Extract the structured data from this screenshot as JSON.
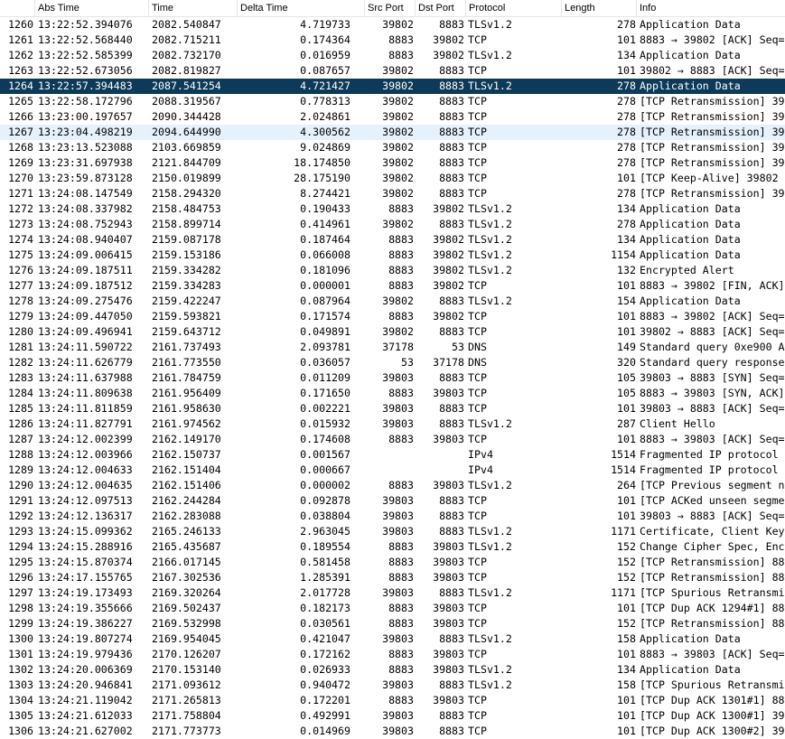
{
  "columns": [
    "",
    "Abs Time",
    "Time",
    "Delta Time",
    "Src Port",
    "Dst Port",
    "Protocol",
    "Length",
    "Info"
  ],
  "selected_no": "1264",
  "hovered_no": "1267",
  "colors": {
    "selected_bg": "#0d3a58",
    "hover_bg": "#e5f1fb"
  },
  "packets": [
    [
      "1260",
      "13:22:52.394076",
      "2082.540847",
      "4.719733",
      "39802",
      "8883",
      "TLSv1.2",
      "278",
      "Application Data"
    ],
    [
      "1261",
      "13:22:52.568440",
      "2082.715211",
      "0.174364",
      "8883",
      "39802",
      "TCP",
      "101",
      "8883 → 39802 [ACK] Seq="
    ],
    [
      "1262",
      "13:22:52.585399",
      "2082.732170",
      "0.016959",
      "8883",
      "39802",
      "TLSv1.2",
      "134",
      "Application Data"
    ],
    [
      "1263",
      "13:22:52.673056",
      "2082.819827",
      "0.087657",
      "39802",
      "8883",
      "TCP",
      "101",
      "39802 → 8883 [ACK] Seq="
    ],
    [
      "1264",
      "13:22:57.394483",
      "2087.541254",
      "4.721427",
      "39802",
      "8883",
      "TLSv1.2",
      "278",
      "Application Data"
    ],
    [
      "1265",
      "13:22:58.172796",
      "2088.319567",
      "0.778313",
      "39802",
      "8883",
      "TCP",
      "278",
      "[TCP Retransmission] 39"
    ],
    [
      "1266",
      "13:23:00.197657",
      "2090.344428",
      "2.024861",
      "39802",
      "8883",
      "TCP",
      "278",
      "[TCP Retransmission] 39"
    ],
    [
      "1267",
      "13:23:04.498219",
      "2094.644990",
      "4.300562",
      "39802",
      "8883",
      "TCP",
      "278",
      "[TCP Retransmission] 39"
    ],
    [
      "1268",
      "13:23:13.523088",
      "2103.669859",
      "9.024869",
      "39802",
      "8883",
      "TCP",
      "278",
      "[TCP Retransmission] 39"
    ],
    [
      "1269",
      "13:23:31.697938",
      "2121.844709",
      "18.174850",
      "39802",
      "8883",
      "TCP",
      "278",
      "[TCP Retransmission] 39"
    ],
    [
      "1270",
      "13:23:59.873128",
      "2150.019899",
      "28.175190",
      "39802",
      "8883",
      "TCP",
      "101",
      "[TCP Keep-Alive] 39802"
    ],
    [
      "1271",
      "13:24:08.147549",
      "2158.294320",
      "8.274421",
      "39802",
      "8883",
      "TCP",
      "278",
      "[TCP Retransmission] 39"
    ],
    [
      "1272",
      "13:24:08.337982",
      "2158.484753",
      "0.190433",
      "8883",
      "39802",
      "TLSv1.2",
      "134",
      "Application Data"
    ],
    [
      "1273",
      "13:24:08.752943",
      "2158.899714",
      "0.414961",
      "39802",
      "8883",
      "TLSv1.2",
      "278",
      "Application Data"
    ],
    [
      "1274",
      "13:24:08.940407",
      "2159.087178",
      "0.187464",
      "8883",
      "39802",
      "TLSv1.2",
      "134",
      "Application Data"
    ],
    [
      "1275",
      "13:24:09.006415",
      "2159.153186",
      "0.066008",
      "8883",
      "39802",
      "TLSv1.2",
      "1154",
      "Application Data"
    ],
    [
      "1276",
      "13:24:09.187511",
      "2159.334282",
      "0.181096",
      "8883",
      "39802",
      "TLSv1.2",
      "132",
      "Encrypted Alert"
    ],
    [
      "1277",
      "13:24:09.187512",
      "2159.334283",
      "0.000001",
      "8883",
      "39802",
      "TCP",
      "101",
      "8883 → 39802 [FIN, ACK]"
    ],
    [
      "1278",
      "13:24:09.275476",
      "2159.422247",
      "0.087964",
      "39802",
      "8883",
      "TLSv1.2",
      "154",
      "Application Data"
    ],
    [
      "1279",
      "13:24:09.447050",
      "2159.593821",
      "0.171574",
      "8883",
      "39802",
      "TCP",
      "101",
      "8883 → 39802 [ACK] Seq="
    ],
    [
      "1280",
      "13:24:09.496941",
      "2159.643712",
      "0.049891",
      "39802",
      "8883",
      "TCP",
      "101",
      "39802 → 8883 [ACK] Seq="
    ],
    [
      "1281",
      "13:24:11.590722",
      "2161.737493",
      "2.093781",
      "37178",
      "53",
      "DNS",
      "149",
      "Standard query 0xe900 A"
    ],
    [
      "1282",
      "13:24:11.626779",
      "2161.773550",
      "0.036057",
      "53",
      "37178",
      "DNS",
      "320",
      "Standard query response"
    ],
    [
      "1283",
      "13:24:11.637988",
      "2161.784759",
      "0.011209",
      "39803",
      "8883",
      "TCP",
      "105",
      "39803 → 8883 [SYN] Seq="
    ],
    [
      "1284",
      "13:24:11.809638",
      "2161.956409",
      "0.171650",
      "8883",
      "39803",
      "TCP",
      "105",
      "8883 → 39803 [SYN, ACK]"
    ],
    [
      "1285",
      "13:24:11.811859",
      "2161.958630",
      "0.002221",
      "39803",
      "8883",
      "TCP",
      "101",
      "39803 → 8883 [ACK] Seq="
    ],
    [
      "1286",
      "13:24:11.827791",
      "2161.974562",
      "0.015932",
      "39803",
      "8883",
      "TLSv1.2",
      "287",
      "Client Hello"
    ],
    [
      "1287",
      "13:24:12.002399",
      "2162.149170",
      "0.174608",
      "8883",
      "39803",
      "TCP",
      "101",
      "8883 → 39803 [ACK] Seq="
    ],
    [
      "1288",
      "13:24:12.003966",
      "2162.150737",
      "0.001567",
      "",
      "",
      "IPv4",
      "1514",
      "Fragmented IP protocol"
    ],
    [
      "1289",
      "13:24:12.004633",
      "2162.151404",
      "0.000667",
      "",
      "",
      "IPv4",
      "1514",
      "Fragmented IP protocol"
    ],
    [
      "1290",
      "13:24:12.004635",
      "2162.151406",
      "0.000002",
      "8883",
      "39803",
      "TLSv1.2",
      "264",
      "[TCP Previous segment n"
    ],
    [
      "1291",
      "13:24:12.097513",
      "2162.244284",
      "0.092878",
      "39803",
      "8883",
      "TCP",
      "101",
      "[TCP ACKed unseen segme"
    ],
    [
      "1292",
      "13:24:12.136317",
      "2162.283088",
      "0.038804",
      "39803",
      "8883",
      "TCP",
      "101",
      "39803 → 8883 [ACK] Seq="
    ],
    [
      "1293",
      "13:24:15.099362",
      "2165.246133",
      "2.963045",
      "39803",
      "8883",
      "TLSv1.2",
      "1171",
      "Certificate, Client Key"
    ],
    [
      "1294",
      "13:24:15.288916",
      "2165.435687",
      "0.189554",
      "8883",
      "39803",
      "TLSv1.2",
      "152",
      "Change Cipher Spec, Enc"
    ],
    [
      "1295",
      "13:24:15.870374",
      "2166.017145",
      "0.581458",
      "8883",
      "39803",
      "TCP",
      "152",
      "[TCP Retransmission] 88"
    ],
    [
      "1296",
      "13:24:17.155765",
      "2167.302536",
      "1.285391",
      "8883",
      "39803",
      "TCP",
      "152",
      "[TCP Retransmission] 88"
    ],
    [
      "1297",
      "13:24:19.173493",
      "2169.320264",
      "2.017728",
      "39803",
      "8883",
      "TLSv1.2",
      "1171",
      "[TCP Spurious Retransmi"
    ],
    [
      "1298",
      "13:24:19.355666",
      "2169.502437",
      "0.182173",
      "8883",
      "39803",
      "TCP",
      "101",
      "[TCP Dup ACK 1294#1] 88"
    ],
    [
      "1299",
      "13:24:19.386227",
      "2169.532998",
      "0.030561",
      "8883",
      "39803",
      "TCP",
      "152",
      "[TCP Retransmission] 88"
    ],
    [
      "1300",
      "13:24:19.807274",
      "2169.954045",
      "0.421047",
      "39803",
      "8883",
      "TLSv1.2",
      "158",
      "Application Data"
    ],
    [
      "1301",
      "13:24:19.979436",
      "2170.126207",
      "0.172162",
      "8883",
      "39803",
      "TCP",
      "101",
      "8883 → 39803 [ACK] Seq="
    ],
    [
      "1302",
      "13:24:20.006369",
      "2170.153140",
      "0.026933",
      "8883",
      "39803",
      "TLSv1.2",
      "134",
      "Application Data"
    ],
    [
      "1303",
      "13:24:20.946841",
      "2171.093612",
      "0.940472",
      "39803",
      "8883",
      "TLSv1.2",
      "158",
      "[TCP Spurious Retransmi"
    ],
    [
      "1304",
      "13:24:21.119042",
      "2171.265813",
      "0.172201",
      "8883",
      "39803",
      "TCP",
      "101",
      "[TCP Dup ACK 1301#1] 88"
    ],
    [
      "1305",
      "13:24:21.612033",
      "2171.758804",
      "0.492991",
      "39803",
      "8883",
      "TCP",
      "101",
      "[TCP Dup ACK 1300#1] 39"
    ],
    [
      "1306",
      "13:24:21.627002",
      "2171.773773",
      "0.014969",
      "39803",
      "8883",
      "TCP",
      "101",
      "[TCP Dup ACK 1300#2] 39"
    ]
  ]
}
